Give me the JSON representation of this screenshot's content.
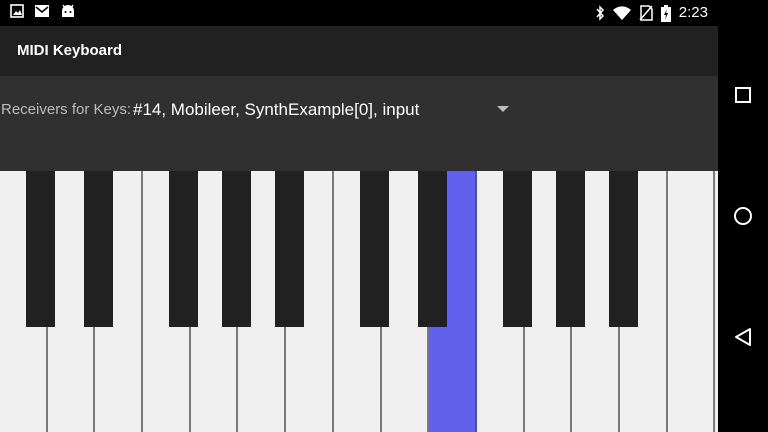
{
  "status_bar": {
    "time": "2:23",
    "left_icons": [
      "image-icon",
      "gmail-icon",
      "android-icon"
    ],
    "right_icons": [
      "bluetooth-icon",
      "wifi-icon",
      "no-sim-icon",
      "battery-charging-icon"
    ]
  },
  "action_bar": {
    "title": "MIDI Keyboard"
  },
  "receiver": {
    "label": "Receivers for Keys:",
    "selected": "#14, Mobileer, SynthExample[0], input"
  },
  "keyboard": {
    "white_key_count": 15,
    "black_key_count": 10,
    "pressed_white_key_index": 9,
    "colors": {
      "white": "#f0f0f0",
      "black": "#212121",
      "pressed": "#6161ee"
    }
  },
  "nav_bar": {
    "buttons": [
      "recents",
      "home",
      "back"
    ]
  }
}
